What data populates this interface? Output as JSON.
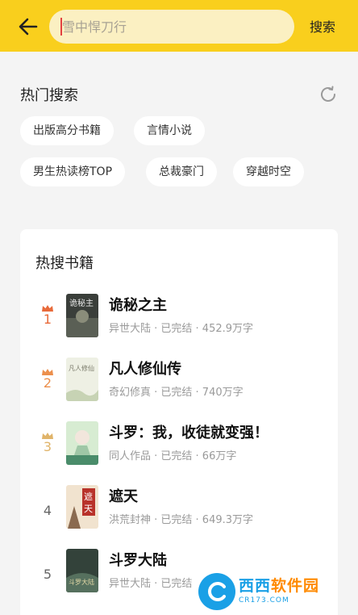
{
  "header": {
    "search_placeholder": "雪中悍刀行",
    "search_button": "搜索"
  },
  "hot_search": {
    "title": "热门搜索",
    "tags": [
      "出版高分书籍",
      "言情小说",
      "男生热读榜TOP",
      "总裁豪门",
      "穿越时空"
    ]
  },
  "hot_books": {
    "title": "热搜书籍",
    "books": [
      {
        "rank": "1",
        "name": "诡秘之主",
        "meta": "异世大陆 · 已完结 · 452.9万字"
      },
      {
        "rank": "2",
        "name": "凡人修仙传",
        "meta": "奇幻修真 · 已完结 · 740万字"
      },
      {
        "rank": "3",
        "name": "斗罗：我，收徒就变强！",
        "meta": "同人作品 · 已完结 · 66万字"
      },
      {
        "rank": "4",
        "name": "遮天",
        "meta": "洪荒封神 · 已完结 · 649.3万字"
      },
      {
        "rank": "5",
        "name": "斗罗大陆",
        "meta": "异世大陆 · 已完结"
      }
    ],
    "rank_colors": [
      "#e86a3a",
      "#ec8f4c",
      "#e0b46a",
      "#666666",
      "#666666"
    ]
  },
  "watermark": {
    "main_a": "西西",
    "main_b": "软件园",
    "sub": "CR173.COM"
  },
  "colors": {
    "brand_yellow": "#f9cf1d",
    "background": "#f4f4f4"
  },
  "icons": {
    "back": "arrow-left-icon",
    "refresh": "refresh-icon",
    "crown": "crown-icon"
  }
}
